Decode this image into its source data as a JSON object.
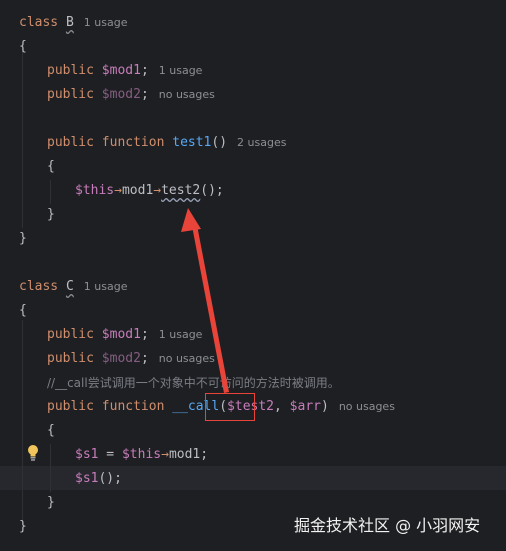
{
  "class_b": {
    "header_kw": "class",
    "name": "B",
    "usage": "1 usage",
    "open_brace": "{",
    "prop1": {
      "kw": "public",
      "var": "$mod1",
      "semi": ";",
      "usage": "1 usage"
    },
    "prop2": {
      "kw": "public",
      "var": "$mod2",
      "semi": ";",
      "usage": "no usages"
    },
    "method": {
      "kw1": "public",
      "kw2": "function",
      "name": "test1",
      "parens": "()",
      "usage": "2 usages"
    },
    "method_open": "{",
    "stmt": {
      "this": "$this",
      "arrow1": "→",
      "mod": "mod1",
      "arrow2": "→",
      "call": "test2",
      "tail": "();"
    },
    "method_close": "}",
    "close_brace": "}"
  },
  "class_c": {
    "header_kw": "class",
    "name": "C",
    "usage": "1 usage",
    "open_brace": "{",
    "prop1": {
      "kw": "public",
      "var": "$mod1",
      "semi": ";",
      "usage": "1 usage"
    },
    "prop2": {
      "kw": "public",
      "var": "$mod2",
      "semi": ";",
      "usage": "no usages"
    },
    "comment": "//__call尝试调用一个对象中不可访问的方法时被调用。",
    "method": {
      "kw1": "public",
      "kw2": "function",
      "name": "__call",
      "open": "(",
      "param1": "$test2",
      "comma": ",",
      "param2": "$arr",
      "close": ")",
      "usage": "no usages"
    },
    "method_open": "{",
    "stmt1": {
      "var": "$s1",
      "eq": " = ",
      "this": "$this",
      "arrow": "→",
      "mod": "mod1",
      "semi": ";"
    },
    "stmt2": {
      "var": "$s1",
      "tail": "();"
    },
    "method_close": "}",
    "close_brace": "}"
  },
  "annotation": {
    "color": "#e8443a"
  },
  "watermark": "掘金技术社区 @ 小羽网安",
  "icons": {
    "bulb": "lightbulb-icon"
  }
}
